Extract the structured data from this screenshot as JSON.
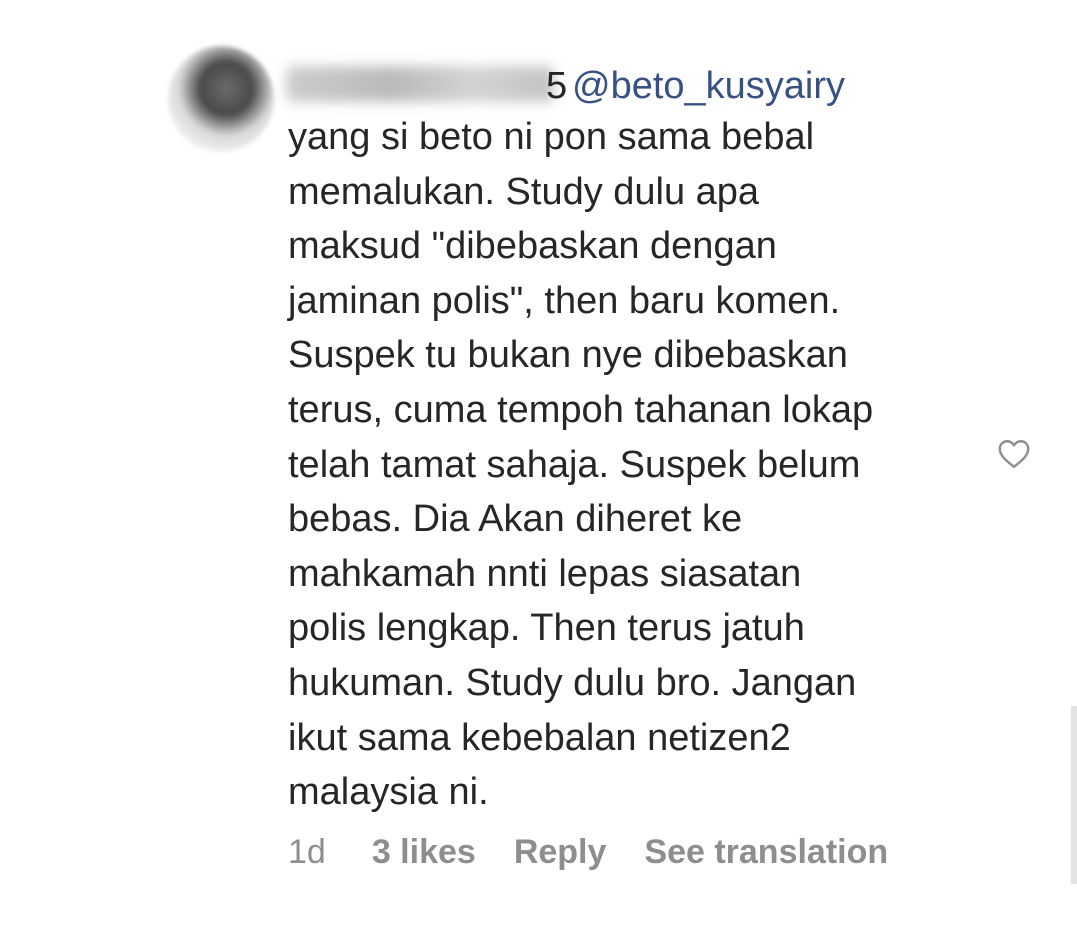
{
  "comment": {
    "username_visible_tail": "5",
    "mention": "@beto_kusyairy",
    "text": "yang si beto ni pon sama bebal\nmemalukan. Study dulu apa\nmaksud \"dibebaskan dengan\njaminan polis\", then baru komen.\nSuspek tu bukan nye dibebaskan\nterus, cuma tempoh tahanan lokap\ntelah tamat sahaja. Suspek belum\nbebas. Dia Akan diheret ke\nmahkamah nnti lepas siasatan\npolis lengkap. Then terus jatuh\nhukuman. Study dulu bro. Jangan\nikut sama kebebalan netizen2\nmalaysia ni.",
    "time": "1d",
    "likes": "3 likes",
    "reply_label": "Reply",
    "translate_label": "See translation",
    "like_icon": "heart-outline-icon"
  }
}
